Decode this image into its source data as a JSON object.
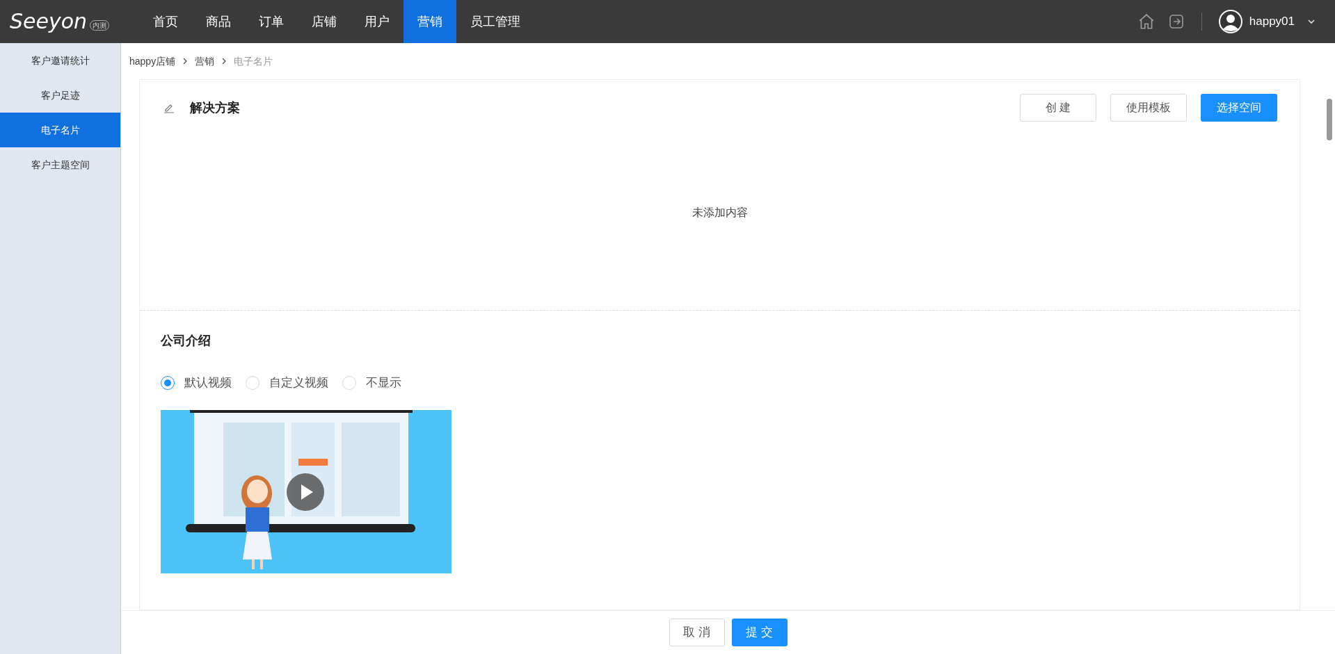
{
  "header": {
    "logo": {
      "text": "Seeyon",
      "badge": "内测"
    },
    "nav": [
      {
        "label": "首页",
        "selected": false
      },
      {
        "label": "商品",
        "selected": false
      },
      {
        "label": "订单",
        "selected": false
      },
      {
        "label": "店铺",
        "selected": false
      },
      {
        "label": "用户",
        "selected": false
      },
      {
        "label": "营销",
        "selected": true
      },
      {
        "label": "员工管理",
        "selected": false
      }
    ],
    "user": "happy01"
  },
  "sidebar": {
    "items": [
      {
        "label": "客户邀请统计",
        "selected": false
      },
      {
        "label": "客户足迹",
        "selected": false
      },
      {
        "label": "电子名片",
        "selected": true
      },
      {
        "label": "客户主题空间",
        "selected": false
      }
    ]
  },
  "breadcrumb": [
    "happy店铺",
    "营销",
    "电子名片"
  ],
  "solution": {
    "title": "解决方案",
    "buttons": [
      {
        "label": "创 建",
        "primary": false
      },
      {
        "label": "使用模板",
        "primary": false
      },
      {
        "label": "选择空间",
        "primary": true
      }
    ],
    "empty_text": "未添加内容"
  },
  "company": {
    "title": "公司介绍",
    "options": [
      {
        "label": "默认视频",
        "selected": true
      },
      {
        "label": "自定义视频",
        "selected": false
      },
      {
        "label": "不显示",
        "selected": false
      }
    ]
  },
  "footer": {
    "buttons": [
      {
        "label": "取 消",
        "primary": false
      },
      {
        "label": "提 交",
        "primary": true
      }
    ]
  }
}
